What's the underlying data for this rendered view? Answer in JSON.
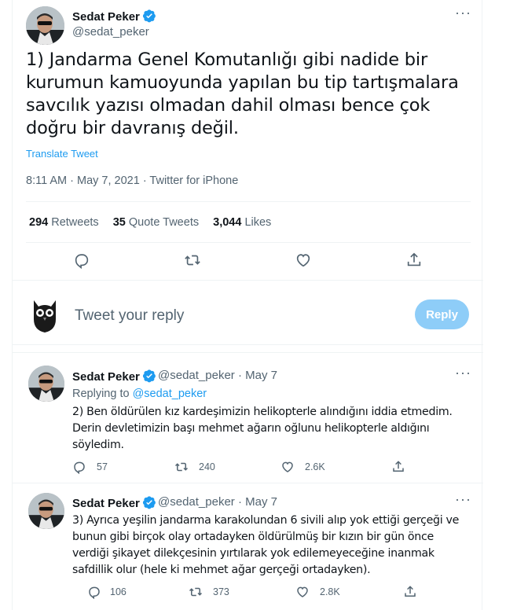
{
  "main_tweet": {
    "author_name": "Sedat Peker",
    "author_handle": "@sedat_peker",
    "text": "1) Jandarma Genel Komutanlığı gibi nadide bir kurumun kamuoyunda yapılan bu tip tartışmalara savcılık yazısı olmadan dahil olması bence çok doğru bir davranış değil.",
    "translate_label": "Translate Tweet",
    "meta": "8:11 AM · May 7, 2021 · Twitter for iPhone",
    "retweets_count": "294",
    "retweets_label": "Retweets",
    "quotes_count": "35",
    "quotes_label": "Quote Tweets",
    "likes_count": "3,044",
    "likes_label": "Likes"
  },
  "reply_box": {
    "placeholder": "Tweet your reply",
    "button_label": "Reply"
  },
  "thread": [
    {
      "author_name": "Sedat Peker",
      "author_handle": "@sedat_peker · May 7",
      "replying_prefix": "Replying to",
      "replying_handle": "@sedat_peker",
      "text": "2) Ben öldürülen kız kardeşimizin helikopterle alındığını iddia etmedim. Derin devletimizin başı mehmet ağarın oğlunu helikopterle aldığını söyledim.",
      "replies": "57",
      "retweets": "240",
      "likes": "2.6K"
    },
    {
      "author_name": "Sedat Peker",
      "author_handle": "@sedat_peker · May 7",
      "text": "3) Ayrıca yeşilin jandarma karakolundan 6 sivili alıp yok ettiği gerçeği ve bunun gibi birçok olay ortadayken öldürülmüş bir kızın bir gün önce verdiği şikayet dilekçesinin yırtılarak yok edilemeyeceğine inanmak safdillik olur (hele ki mehmet ağar gerçeği ortadayken).",
      "replies": "106",
      "retweets": "373",
      "likes": "2.8K"
    }
  ],
  "colors": {
    "accent": "#1d9bf0",
    "text": "#0f1419",
    "muted": "#536471",
    "border": "#eff3f4",
    "reply_button_disabled": "#8ecdf8"
  },
  "icons": [
    "verified-badge-icon",
    "more-icon",
    "reply-icon",
    "retweet-icon",
    "like-icon",
    "share-icon",
    "owl-avatar-icon"
  ]
}
